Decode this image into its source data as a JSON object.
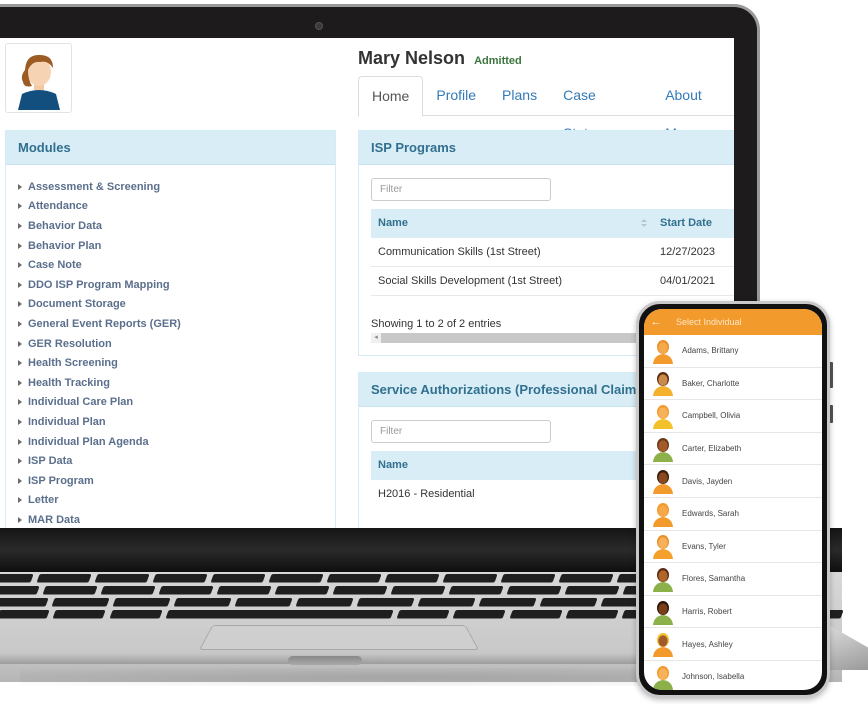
{
  "patient": {
    "name": "Mary Nelson",
    "status": "Admitted"
  },
  "tabs": [
    {
      "label": "Home",
      "active": true
    },
    {
      "label": "Profile"
    },
    {
      "label": "Plans"
    },
    {
      "label": "Case Status"
    },
    {
      "label": "About Me"
    }
  ],
  "modules": {
    "title": "Modules",
    "items": [
      "Assessment & Screening",
      "Attendance",
      "Behavior Data",
      "Behavior Plan",
      "Case Note",
      "DDO ISP Program Mapping",
      "Document Storage",
      "General Event Reports (GER)",
      "GER Resolution",
      "Health Screening",
      "Health Tracking",
      "Individual Care Plan",
      "Individual Plan",
      "Individual Plan Agenda",
      "ISP Data",
      "ISP Program",
      "Letter",
      "MAR Data"
    ]
  },
  "isp_programs": {
    "title": "ISP Programs",
    "filter_placeholder": "Filter",
    "columns": [
      "Name",
      "Start Date"
    ],
    "rows": [
      [
        "Communication Skills (1st Street)",
        "12/27/2023"
      ],
      [
        "Social Skills Development (1st Street)",
        "04/01/2021"
      ]
    ],
    "info": "Showing 1 to 2 of 2 entries"
  },
  "service_authorizations": {
    "title": "Service Authorizations (Professional Claim)",
    "filter_placeholder": "Filter",
    "columns": [
      "Name"
    ],
    "rows": [
      [
        "H2016 - Residential"
      ]
    ]
  },
  "phone": {
    "title": "Select Individual",
    "accent": "#f39a2c",
    "individuals": [
      {
        "name": "Adams, Brittany",
        "skin": "#f6a94a",
        "shirt": "#f39a2c",
        "hair": "#e8912c"
      },
      {
        "name": "Baker, Charlotte",
        "skin": "#c98a4b",
        "shirt": "#f3b12c",
        "hair": "#5a2d12"
      },
      {
        "name": "Campbell, Olivia",
        "skin": "#f6b25a",
        "shirt": "#f3c12c",
        "hair": "#f39a2c"
      },
      {
        "name": "Carter, Elizabeth",
        "skin": "#a35a2a",
        "shirt": "#8cb04a",
        "hair": "#6b3a1a"
      },
      {
        "name": "Davis, Jayden",
        "skin": "#8a4a20",
        "shirt": "#f39a2c",
        "hair": "#3a1e0a"
      },
      {
        "name": "Edwards, Sarah",
        "skin": "#f6a94a",
        "shirt": "#f39a2c",
        "hair": "#f39a2c"
      },
      {
        "name": "Evans, Tyler",
        "skin": "#f6b25a",
        "shirt": "#f3a12c",
        "hair": "#e8912c"
      },
      {
        "name": "Flores, Samantha",
        "skin": "#b0652a",
        "shirt": "#8cb04a",
        "hair": "#5a2d12"
      },
      {
        "name": "Harris, Robert",
        "skin": "#7a3e18",
        "shirt": "#8cb04a",
        "hair": "#2a1608"
      },
      {
        "name": "Hayes, Ashley",
        "skin": "#a35a2a",
        "shirt": "#f39a2c",
        "hair": "#f3c12c"
      },
      {
        "name": "Johnson, Isabella",
        "skin": "#f6b25a",
        "shirt": "#8cb04a",
        "hair": "#f39a2c"
      }
    ]
  }
}
